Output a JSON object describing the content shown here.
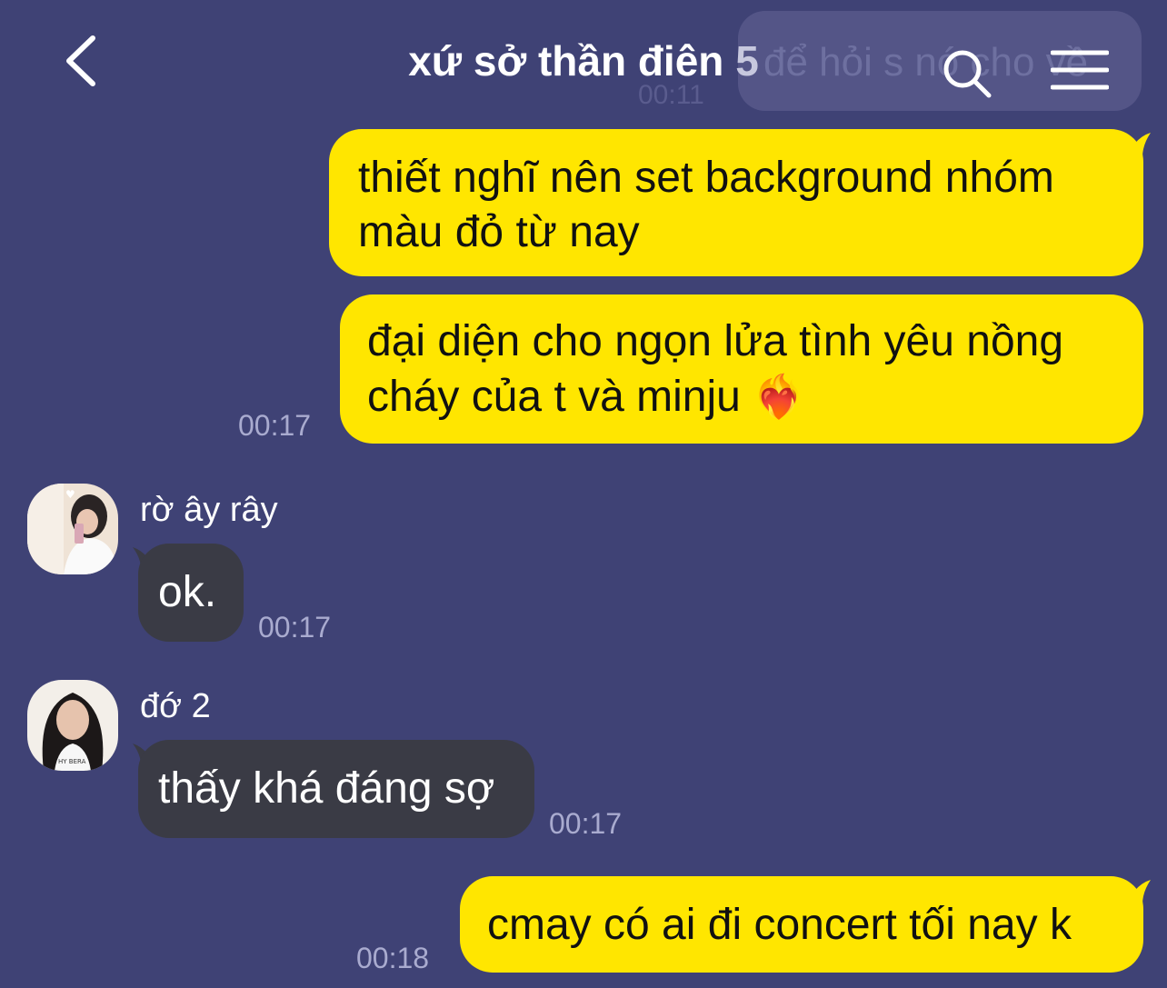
{
  "header": {
    "title": "xứ sở thần điên",
    "member_count": "5"
  },
  "previous_message": {
    "text": "để hỏi s nó cho về",
    "time": "00:11"
  },
  "messages": [
    {
      "sender": "me",
      "text": "thiết nghĩ nên set background nhóm màu đỏ từ nay",
      "time": ""
    },
    {
      "sender": "me",
      "text": "đại diện cho ngọn lửa tình yêu nồng cháy của t và minju",
      "emoji": "❤️‍🔥",
      "time": "00:17"
    },
    {
      "sender": "rờ ây rây",
      "text": "ok.",
      "time": "00:17"
    },
    {
      "sender": "đớ 2",
      "text": "thấy khá đáng sợ",
      "time": "00:17"
    },
    {
      "sender": "me",
      "text": "cmay có ai đi concert tối nay k",
      "time": "00:18"
    }
  ],
  "colors": {
    "background": "#3f4275",
    "my_bubble": "#ffe600",
    "other_bubble": "#3a3b45",
    "time_text": "#a9abcf"
  },
  "icons": [
    "chevron-left-icon",
    "search-icon",
    "menu-icon",
    "heart-on-fire-emoji"
  ]
}
